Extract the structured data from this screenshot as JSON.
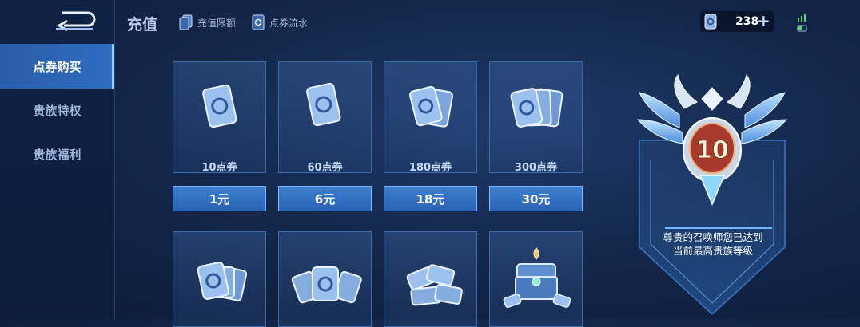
{
  "sidebar": {
    "items": [
      {
        "label": "点券购买",
        "active": true
      },
      {
        "label": "贵族特权",
        "active": false
      },
      {
        "label": "贵族福利",
        "active": false
      }
    ]
  },
  "header": {
    "title": "充值",
    "links": [
      {
        "label": "充值限额",
        "icon": "card-icon"
      },
      {
        "label": "点券流水",
        "icon": "ticket-icon"
      }
    ]
  },
  "currency": {
    "amount": "238",
    "icon": "voucher-icon",
    "add_icon": "plus-icon"
  },
  "products": [
    {
      "label": "10点券",
      "price": "1元",
      "art": "single-card"
    },
    {
      "label": "60点券",
      "price": "6元",
      "art": "single-card"
    },
    {
      "label": "180点券",
      "price": "18元",
      "art": "double-card"
    },
    {
      "label": "300点券",
      "price": "30元",
      "art": "triple-card"
    },
    {
      "art": "card-fan"
    },
    {
      "art": "card-pile"
    },
    {
      "art": "card-stack"
    },
    {
      "art": "treasure-chest"
    }
  ],
  "noble": {
    "level": "10",
    "message_line1": "尊贵的召唤师您已达到",
    "message_line2": "当前最高贵族等级"
  },
  "colors": {
    "accent": "#2f6cc0",
    "button_border": "#7fb8ff",
    "background": "#14284c"
  }
}
